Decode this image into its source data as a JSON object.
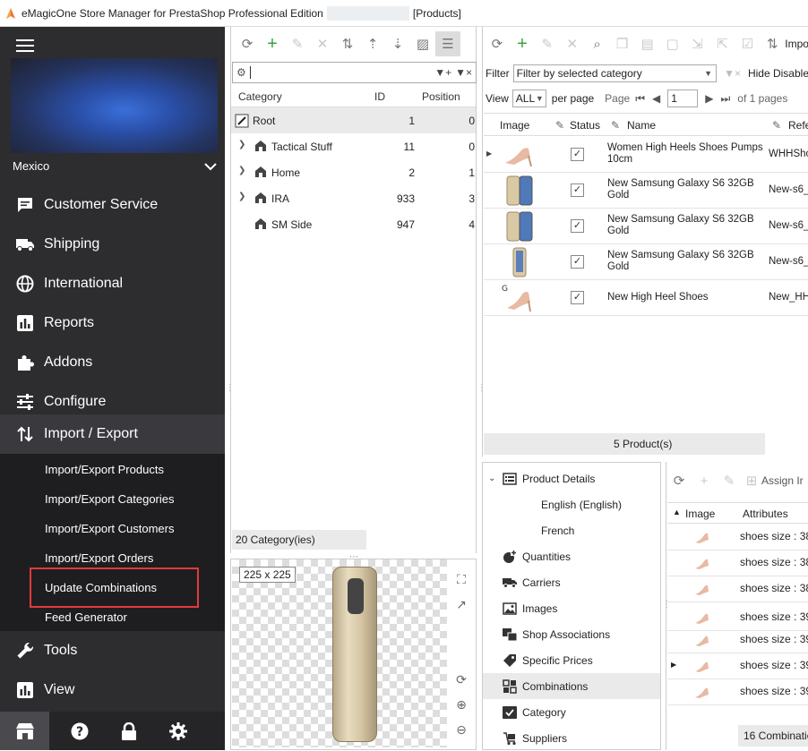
{
  "window": {
    "title": "eMagicOne Store Manager for PrestaShop Professional Edition",
    "section": "[Products]"
  },
  "sidebar": {
    "store_name": "Mexico",
    "items": [
      {
        "label": "Customer Service",
        "icon": "chat-icon"
      },
      {
        "label": "Shipping",
        "icon": "truck-icon"
      },
      {
        "label": "International",
        "icon": "globe-icon"
      },
      {
        "label": "Reports",
        "icon": "bar-chart-icon"
      },
      {
        "label": "Addons",
        "icon": "puzzle-icon"
      },
      {
        "label": "Configure",
        "icon": "sliders-icon"
      },
      {
        "label": "Import / Export",
        "icon": "arrows-icon"
      },
      {
        "label": "Tools",
        "icon": "wrench-icon"
      },
      {
        "label": "View",
        "icon": "chart-view-icon"
      }
    ],
    "subitems": [
      "Import/Export Products",
      "Import/Export Categories",
      "Import/Export Customers",
      "Import/Export Orders",
      "Update Combinations",
      "Feed Generator"
    ]
  },
  "categories": {
    "columns": {
      "category": "Category",
      "id": "ID",
      "position": "Position"
    },
    "rows": [
      {
        "name": "Root",
        "id": "1",
        "position": "0"
      },
      {
        "name": "Tactical Stuff",
        "id": "11",
        "position": "0"
      },
      {
        "name": "Home",
        "id": "2",
        "position": "1"
      },
      {
        "name": "IRA",
        "id": "933",
        "position": "3"
      },
      {
        "name": "SM Side",
        "id": "947",
        "position": "4"
      }
    ],
    "count": "20 Category(ies)"
  },
  "image_preview": {
    "size": "225 x 225"
  },
  "products": {
    "toolbar_import": "Impo",
    "filter_label": "Filter",
    "filter_value": "Filter by selected category",
    "hide_disabled": "Hide Disable",
    "view_label": "View",
    "per_page_value": "ALL",
    "per_page_label": "per page",
    "page_label": "Page",
    "page_value": "1",
    "pages_of": "of 1 pages",
    "columns": {
      "image": "Image",
      "status": "Status",
      "name": "Name",
      "ref": "Refe"
    },
    "rows": [
      {
        "name": "Women High Heels Shoes Pumps 10cm",
        "ref": "WHHSho"
      },
      {
        "name": "New Samsung Galaxy S6 32GB Gold",
        "ref": "New-s6_"
      },
      {
        "name": "New Samsung Galaxy S6 32GB Gold",
        "ref": "New-s6_"
      },
      {
        "name": "New Samsung Galaxy S6 32GB Gold",
        "ref": "New-s6_"
      },
      {
        "name": "New High Heel Shoes",
        "ref": "New_HH"
      }
    ],
    "count": "5 Product(s)"
  },
  "details": {
    "items": [
      {
        "label": "Product Details",
        "icon": "details-icon"
      },
      {
        "label": "English (English)",
        "icon": ""
      },
      {
        "label": "French",
        "icon": ""
      },
      {
        "label": "Quantities",
        "icon": "quantities-icon"
      },
      {
        "label": "Carriers",
        "icon": "carriers-icon"
      },
      {
        "label": "Images",
        "icon": "images-icon"
      },
      {
        "label": "Shop Associations",
        "icon": "shop-icon"
      },
      {
        "label": "Specific Prices",
        "icon": "price-tag-icon"
      },
      {
        "label": "Combinations",
        "icon": "combinations-icon"
      },
      {
        "label": "Category",
        "icon": "category-icon"
      },
      {
        "label": "Suppliers",
        "icon": "suppliers-icon"
      }
    ]
  },
  "combinations": {
    "assign_label": "Assign Ir",
    "columns": {
      "image": "Image",
      "attributes": "Attributes"
    },
    "rows": [
      "shoes size : 38,",
      "shoes size : 38,",
      "shoes size : 38,",
      "shoes size : 39,",
      "shoes size : 39,",
      "shoes size : 39,",
      "shoes size : 39,"
    ],
    "count": "16 Combinations"
  }
}
